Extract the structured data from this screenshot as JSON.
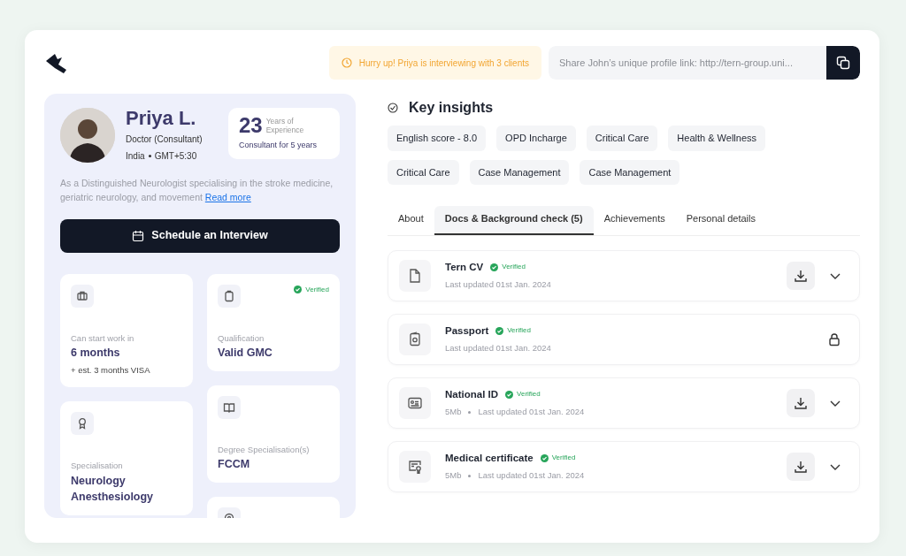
{
  "alert": {
    "text": "Hurry up! Priya is interviewing with 3 clients"
  },
  "share": {
    "placeholder": "Share John’s unique profile link: http://tern-group.uni..."
  },
  "profile": {
    "name": "Priya L.",
    "role": "Doctor (Consultant)",
    "country": "India",
    "timezone": "GMT+5:30",
    "experience_number": "23",
    "experience_label": "Years of Experience",
    "experience_note": "Consultant for 5 years",
    "description": "As a Distinguished Neurologist specialising in the stroke medicine, geriatric neurology, and movement",
    "read_more": "Read more",
    "schedule_button": "Schedule an Interview"
  },
  "info_columns": [
    [
      {
        "label": "Can start work in",
        "values": [
          "6 months"
        ],
        "note": "+ est. 3 months VISA",
        "verified": false
      },
      {
        "label": "Specialisation",
        "values": [
          "Neurology",
          "Anesthesiology"
        ],
        "verified": false
      }
    ],
    [
      {
        "label": "Qualification",
        "values": [
          "Valid GMC"
        ],
        "verified": true,
        "verified_label": "Verified"
      },
      {
        "label": "Degree Specialisation(s)",
        "values": [
          "FCCM"
        ],
        "verified": false
      },
      {
        "verified": false
      }
    ]
  ],
  "key_insights": {
    "title": "Key insights",
    "tags": [
      "English score - 8.0",
      "OPD Incharge",
      "Critical Care",
      "Health & Wellness",
      "Critical Care",
      "Case Management",
      "Case Management"
    ]
  },
  "tabs": [
    {
      "label": "About",
      "selected": false
    },
    {
      "label": "Docs & Background check (5)",
      "selected": true
    },
    {
      "label": "Achievements",
      "selected": false
    },
    {
      "label": "Personal details",
      "selected": false
    }
  ],
  "documents": [
    {
      "name": "Tern CV",
      "verified": true,
      "verified_label": "Verified",
      "meta": [
        "Last updated 01st Jan. 2024"
      ],
      "kind": "download"
    },
    {
      "name": "Passport",
      "verified": true,
      "verified_label": "Verified",
      "meta": [
        "Last updated 01st Jan. 2024"
      ],
      "kind": "locked"
    },
    {
      "name": "National ID",
      "verified": true,
      "verified_label": "Verified",
      "meta": [
        "5Mb",
        "Last updated 01st Jan. 2024"
      ],
      "kind": "download"
    },
    {
      "name": "Medical certificate",
      "verified": true,
      "verified_label": "Verified",
      "meta": [
        "5Mb",
        "Last updated 01st Jan. 2024"
      ],
      "kind": "download"
    }
  ]
}
